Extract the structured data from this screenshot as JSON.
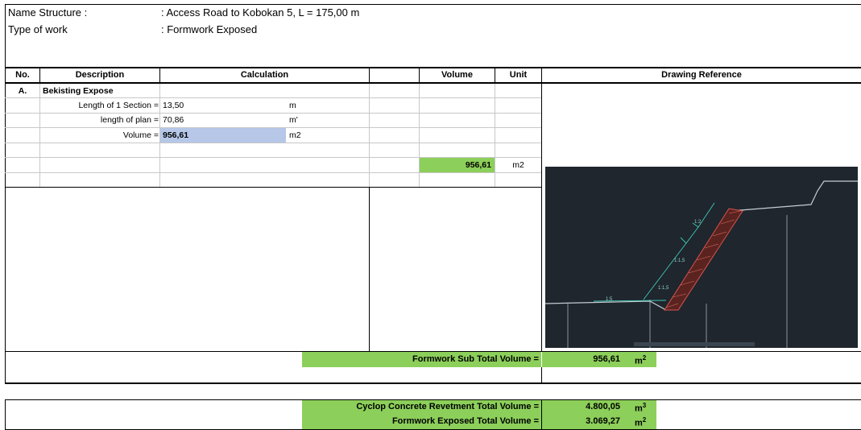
{
  "header": {
    "name_label": "Name Structure :",
    "name_value": ": Access Road to Kobokan 5, L = 175,00 m",
    "type_label": "Type of work",
    "type_value": ": Formwork Exposed"
  },
  "columns": {
    "no": "No.",
    "description": "Description",
    "calculation": "Calculation",
    "volume": "Volume",
    "unit": "Unit",
    "drawing": "Drawing Reference"
  },
  "section": {
    "no": "A.",
    "title": "Bekisting Expose"
  },
  "rows": [
    {
      "label": "Length of 1 Section =",
      "value": "13,50",
      "unit": "m"
    },
    {
      "label": "length of plan =",
      "value": "70,86",
      "unit": "m'"
    },
    {
      "label": "Volume =",
      "value": "956,61",
      "unit": "m2"
    }
  ],
  "volume_result": {
    "value": "956,61",
    "unit": "m2"
  },
  "drawing": {
    "labels": [
      "1:2",
      "1:1,5",
      "1:1,5",
      "1:5"
    ]
  },
  "subtotal": {
    "label": "Formwork Sub Total Volume =",
    "value": "956,61",
    "unit": "m",
    "unit_sup": "2"
  },
  "totals": [
    {
      "label": "Cyclop Concrete Revetment Total Volume =",
      "value": "4.800,05",
      "unit": "m",
      "unit_sup": "3"
    },
    {
      "label": "Formwork Exposed Total Volume =",
      "value": "3.069,27",
      "unit": "m",
      "unit_sup": "2"
    }
  ],
  "colors": {
    "green": "#8ccf5a",
    "blue": "#b6c7e8",
    "drawing_bg": "#1f262d"
  }
}
